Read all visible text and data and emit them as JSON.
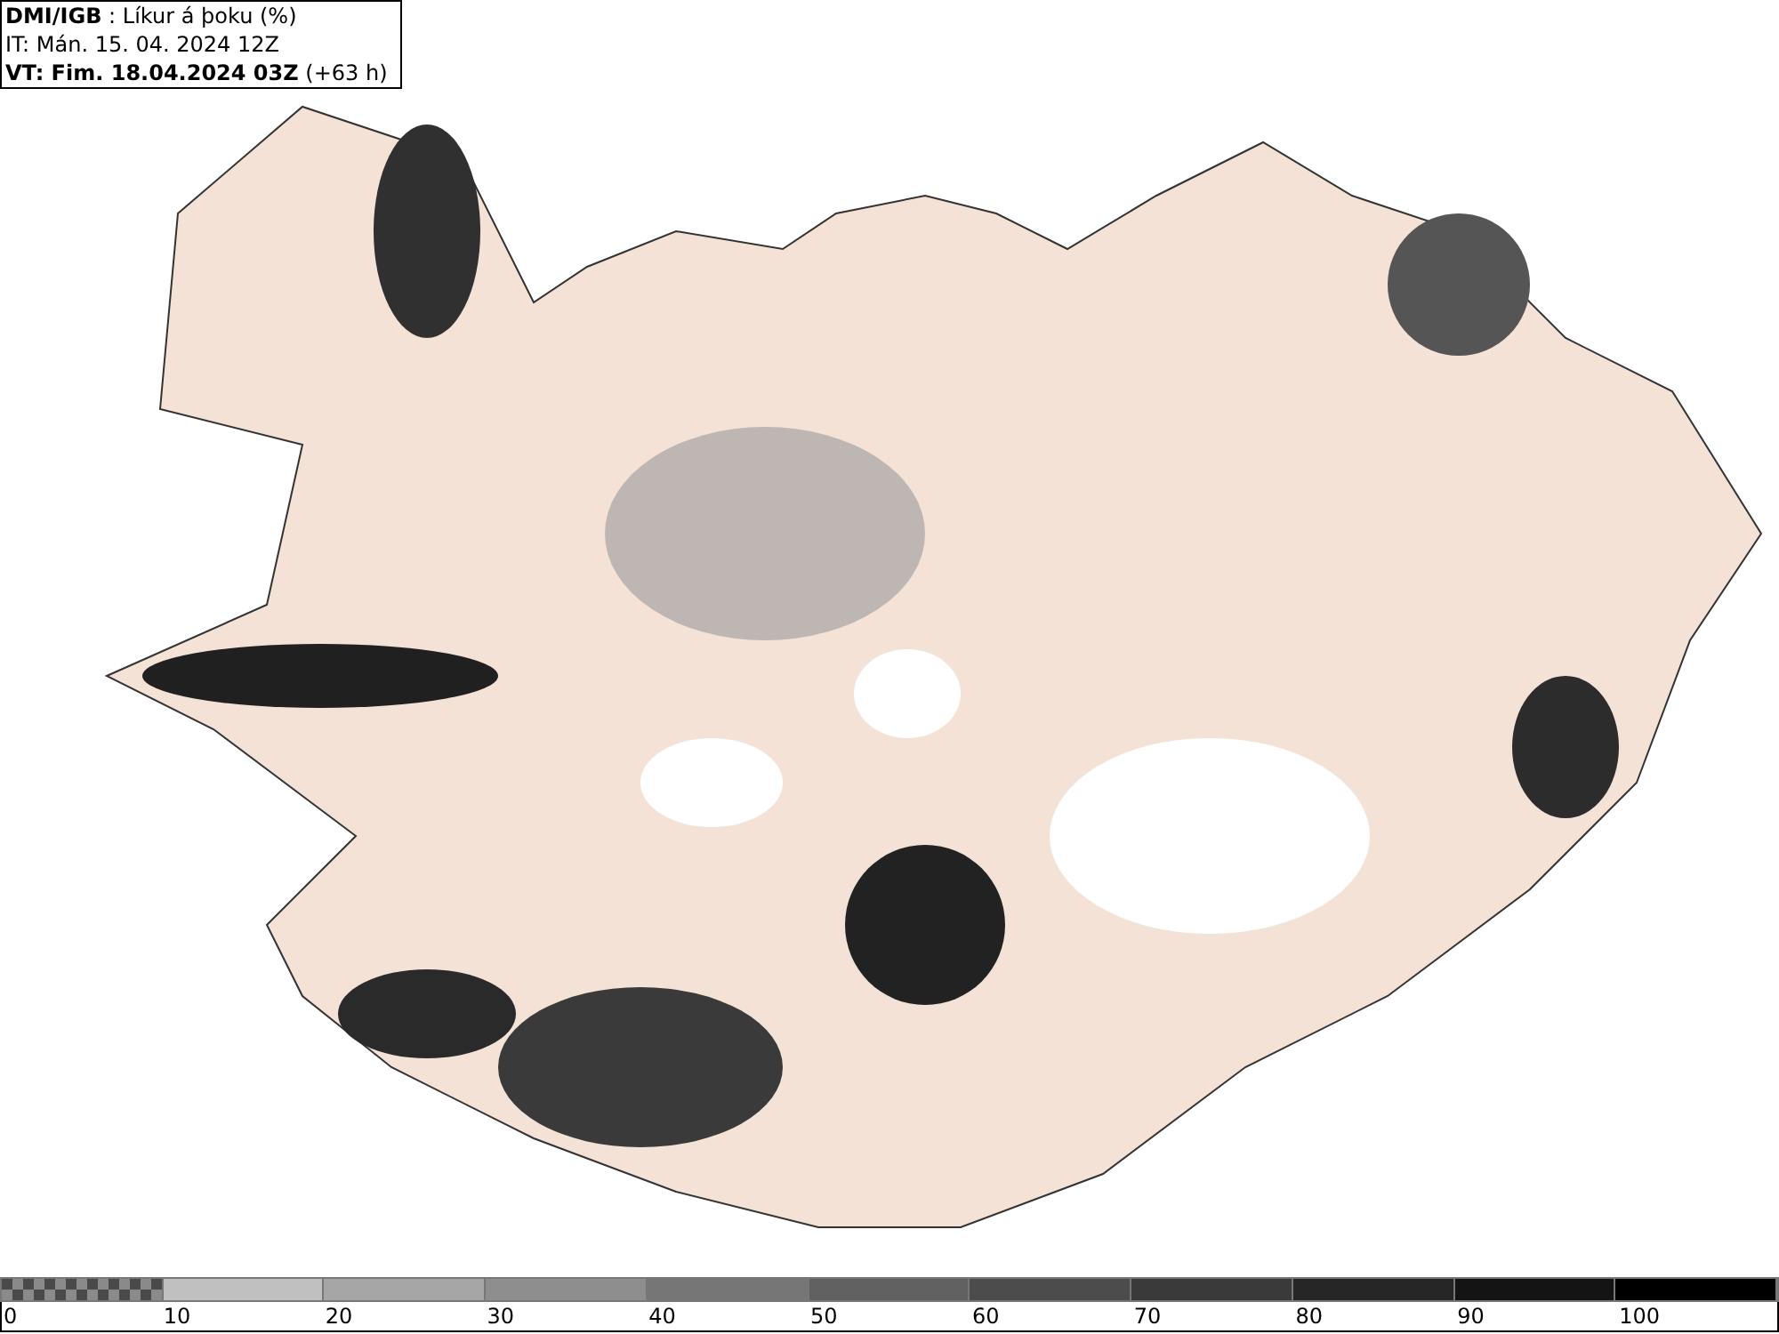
{
  "header": {
    "source": "DMI/IGB",
    "field": ": Líkur á þoku (%)",
    "issue": "IT: Mán. 15. 04. 2024 12Z",
    "valid": "VT: Fim. 18.04.2024 03Z",
    "lead": "(+63 h)"
  },
  "legend": {
    "segments": [
      {
        "kind": "pattern",
        "color": "#8a8a8a"
      },
      {
        "kind": "solid",
        "color": "#c0c0c0"
      },
      {
        "kind": "solid",
        "color": "#a6a6a6"
      },
      {
        "kind": "solid",
        "color": "#8e8e8e"
      },
      {
        "kind": "solid",
        "color": "#767676"
      },
      {
        "kind": "solid",
        "color": "#606060"
      },
      {
        "kind": "solid",
        "color": "#4c4c4c"
      },
      {
        "kind": "solid",
        "color": "#3a3a3a"
      },
      {
        "kind": "solid",
        "color": "#262626"
      },
      {
        "kind": "solid",
        "color": "#141414"
      },
      {
        "kind": "solid",
        "color": "#000000"
      }
    ],
    "labels": [
      "0",
      "10",
      "20",
      "30",
      "40",
      "50",
      "60",
      "70",
      "80",
      "90",
      "100"
    ]
  }
}
